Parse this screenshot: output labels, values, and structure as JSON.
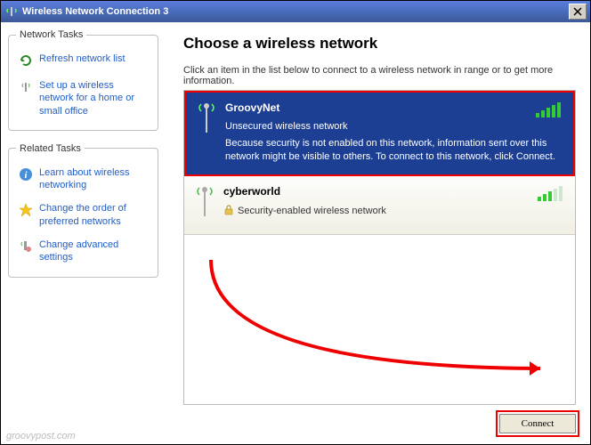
{
  "title": "Wireless Network Connection 3",
  "sidebar": {
    "group1_legend": "Network Tasks",
    "group2_legend": "Related Tasks",
    "refresh": "Refresh network list",
    "setup": "Set up a wireless network for a home or small office",
    "learn": "Learn about wireless networking",
    "order": "Change the order of preferred networks",
    "advanced": "Change advanced settings"
  },
  "main": {
    "heading": "Choose a wireless network",
    "instructions": "Click an item in the list below to connect to a wireless network in range or to get more information.",
    "connect_label": "Connect"
  },
  "networks": [
    {
      "name": "GroovyNet",
      "status": "Unsecured wireless network",
      "desc": "Because security is not enabled on this network, information sent over this network might be visible to others. To connect to this network, click Connect.",
      "selected": true,
      "secured": false
    },
    {
      "name": "cyberworld",
      "status": "Security-enabled wireless network",
      "desc": "",
      "selected": false,
      "secured": true
    }
  ],
  "watermark": "groovypost.com"
}
